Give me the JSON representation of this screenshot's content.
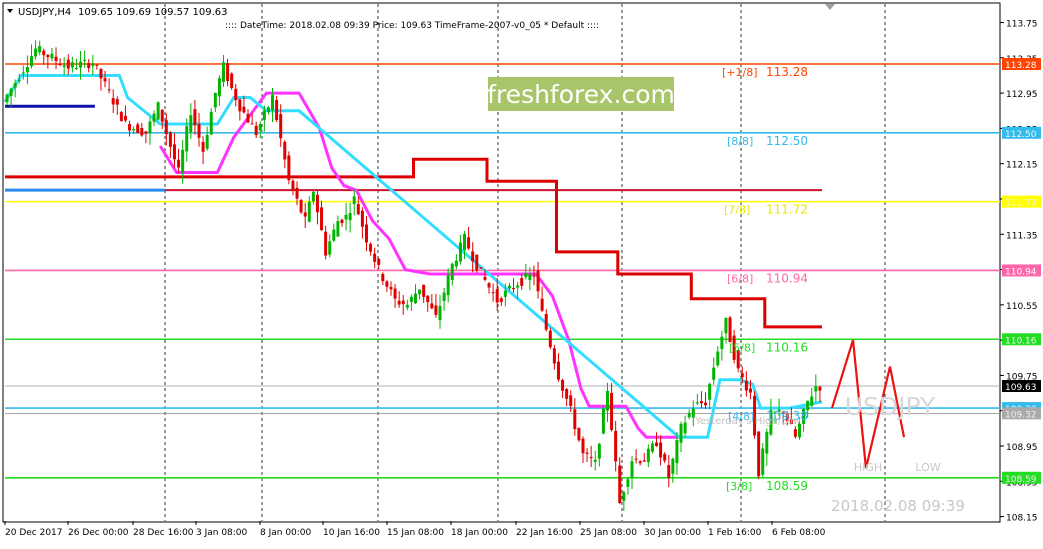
{
  "header": {
    "symbol_label": "USDJPY,H4",
    "ohlc": "109.65 109.69 109.57 109.63",
    "info": ":::: DateTime: 2018.02.08 09:39    Price: 109.63    TimeFrame-2007-v0_05    *   Default   ::::"
  },
  "watermark": "freshforex.com",
  "overlay": {
    "symbol": "USDJPY",
    "high_label": "HIGH",
    "low_label": "LOW",
    "datetime": "2018.02.08 09:39",
    "yesterday_label": "Yesterday's High/Low"
  },
  "colors": {
    "background": "#ffffff",
    "bull_candle": "#00b400",
    "bear_candle": "#e00000",
    "cyan_line": "#33ddff",
    "magenta_line": "#ff33ff",
    "red_step_line": "#dd0000",
    "blue_line": "#1010aa",
    "price_label_bg": "#000000"
  },
  "chart_data": {
    "type": "candlestick",
    "symbol": "USDJPY",
    "timeframe": "H4",
    "ylim": [
      108.1,
      113.96
    ],
    "y_ticks": [
      "113.75",
      "113.35",
      "112.95",
      "112.55",
      "112.15",
      "111.75",
      "111.35",
      "110.95",
      "110.55",
      "110.15",
      "109.75",
      "109.35",
      "108.95",
      "108.55",
      "108.15"
    ],
    "x_ticks": [
      "20 Dec 2017",
      "26 Dec 00:00",
      "28 Dec 16:00",
      "3 Jan 08:00",
      "8 Jan 00:00",
      "10 Jan 16:00",
      "15 Jan 08:00",
      "18 Jan 00:00",
      "22 Jan 16:00",
      "25 Jan 08:00",
      "30 Jan 00:00",
      "1 Feb 16:00",
      "6 Feb 08:00"
    ],
    "levels": [
      {
        "label": "[+1/8]",
        "value": "113.28",
        "color": "#ff4400"
      },
      {
        "label": "[8/8]",
        "value": "112.50",
        "color": "#33bbee"
      },
      {
        "label": "[7/8]",
        "value": "111.72",
        "color": "#ffff00"
      },
      {
        "label": "[6/8]",
        "value": "110.94",
        "color": "#ff66aa"
      },
      {
        "label": "[5/8]",
        "value": "110.16",
        "color": "#22dd22"
      },
      {
        "label": "[4/8]",
        "value": "109.38",
        "color": "#33bbee"
      },
      {
        "label": "[3/8]",
        "value": "108.59",
        "color": "#22dd22"
      }
    ],
    "side_price_labels": [
      "113.28",
      "112.50",
      "111.72",
      "110.94",
      "110.16",
      "109.63",
      "109.38",
      "109.32",
      "108.59"
    ],
    "current_price": "109.63",
    "extra_line": 109.32,
    "price_waypoints": [
      [
        0,
        112.85
      ],
      [
        8,
        113.45
      ],
      [
        16,
        113.25
      ],
      [
        22,
        113.3
      ],
      [
        26,
        112.95
      ],
      [
        30,
        112.6
      ],
      [
        35,
        112.5
      ],
      [
        38,
        112.8
      ],
      [
        40,
        112.5
      ],
      [
        43,
        112.05
      ],
      [
        46,
        112.75
      ],
      [
        49,
        112.3
      ],
      [
        52,
        112.95
      ],
      [
        54,
        113.25
      ],
      [
        56,
        113.0
      ],
      [
        58,
        112.8
      ],
      [
        62,
        112.5
      ],
      [
        66,
        112.9
      ],
      [
        70,
        111.95
      ],
      [
        74,
        111.5
      ],
      [
        76,
        111.85
      ],
      [
        79,
        111.15
      ],
      [
        82,
        111.5
      ],
      [
        84,
        111.55
      ],
      [
        86,
        111.75
      ],
      [
        89,
        111.3
      ],
      [
        92,
        110.95
      ],
      [
        96,
        110.6
      ],
      [
        99,
        110.55
      ],
      [
        102,
        110.75
      ],
      [
        106,
        110.4
      ],
      [
        110,
        111.0
      ],
      [
        113,
        111.3
      ],
      [
        117,
        110.9
      ],
      [
        121,
        110.6
      ],
      [
        126,
        110.8
      ],
      [
        130,
        110.9
      ],
      [
        132,
        110.45
      ],
      [
        136,
        109.75
      ],
      [
        139,
        109.35
      ],
      [
        142,
        108.85
      ],
      [
        145,
        108.75
      ],
      [
        148,
        109.6
      ],
      [
        151,
        108.3
      ],
      [
        154,
        108.8
      ],
      [
        157,
        108.8
      ],
      [
        160,
        109.0
      ],
      [
        163,
        108.6
      ],
      [
        166,
        109.15
      ],
      [
        169,
        109.4
      ],
      [
        172,
        109.45
      ],
      [
        175,
        110.05
      ],
      [
        177,
        110.35
      ],
      [
        180,
        109.8
      ],
      [
        183,
        109.55
      ],
      [
        185,
        108.65
      ],
      [
        188,
        109.3
      ],
      [
        191,
        109.35
      ],
      [
        194,
        109.05
      ],
      [
        197,
        109.45
      ],
      [
        199,
        109.63
      ]
    ],
    "red_step_line": [
      [
        0,
        112.0
      ],
      [
        100,
        112.0
      ],
      [
        100,
        112.2
      ],
      [
        118,
        112.2
      ],
      [
        118,
        111.95
      ],
      [
        135,
        111.95
      ],
      [
        135,
        111.15
      ],
      [
        150,
        111.15
      ],
      [
        150,
        110.9
      ],
      [
        168,
        110.9
      ],
      [
        168,
        110.62
      ],
      [
        186,
        110.62
      ],
      [
        186,
        110.3
      ],
      [
        200,
        110.3
      ]
    ],
    "magenta_line": [
      [
        38,
        112.35
      ],
      [
        42,
        112.05
      ],
      [
        52,
        112.05
      ],
      [
        56,
        112.45
      ],
      [
        64,
        112.95
      ],
      [
        72,
        112.95
      ],
      [
        77,
        112.55
      ],
      [
        80,
        112.1
      ],
      [
        83,
        111.9
      ],
      [
        86,
        111.85
      ],
      [
        90,
        111.5
      ],
      [
        94,
        111.3
      ],
      [
        98,
        110.95
      ],
      [
        104,
        110.9
      ],
      [
        108,
        110.9
      ],
      [
        124,
        110.9
      ],
      [
        130,
        110.9
      ],
      [
        134,
        110.65
      ],
      [
        138,
        110.15
      ],
      [
        141,
        109.6
      ],
      [
        143,
        109.4
      ],
      [
        148,
        109.4
      ],
      [
        152,
        109.4
      ],
      [
        155,
        109.15
      ],
      [
        157,
        109.05
      ],
      [
        165,
        109.05
      ]
    ],
    "cyan_line": [
      [
        0,
        112.85
      ],
      [
        4,
        113.15
      ],
      [
        10,
        113.15
      ],
      [
        16,
        113.15
      ],
      [
        22,
        113.15
      ],
      [
        28,
        113.15
      ],
      [
        30,
        112.9
      ],
      [
        38,
        112.6
      ],
      [
        52,
        112.6
      ],
      [
        56,
        112.9
      ],
      [
        60,
        112.9
      ],
      [
        64,
        112.75
      ],
      [
        72,
        112.75
      ],
      [
        165,
        109.05
      ],
      [
        172,
        109.05
      ],
      [
        175,
        109.7
      ],
      [
        180,
        109.7
      ],
      [
        183,
        109.65
      ],
      [
        185,
        109.38
      ],
      [
        192,
        109.38
      ],
      [
        200,
        109.45
      ]
    ],
    "blue_line": [
      [
        0,
        112.8
      ],
      [
        22,
        112.8
      ]
    ],
    "zigzag_projection": [
      [
        0,
        109.38
      ],
      [
        1,
        110.15
      ],
      [
        2,
        108.7
      ],
      [
        3,
        109.85
      ],
      [
        4,
        109.05
      ]
    ]
  }
}
